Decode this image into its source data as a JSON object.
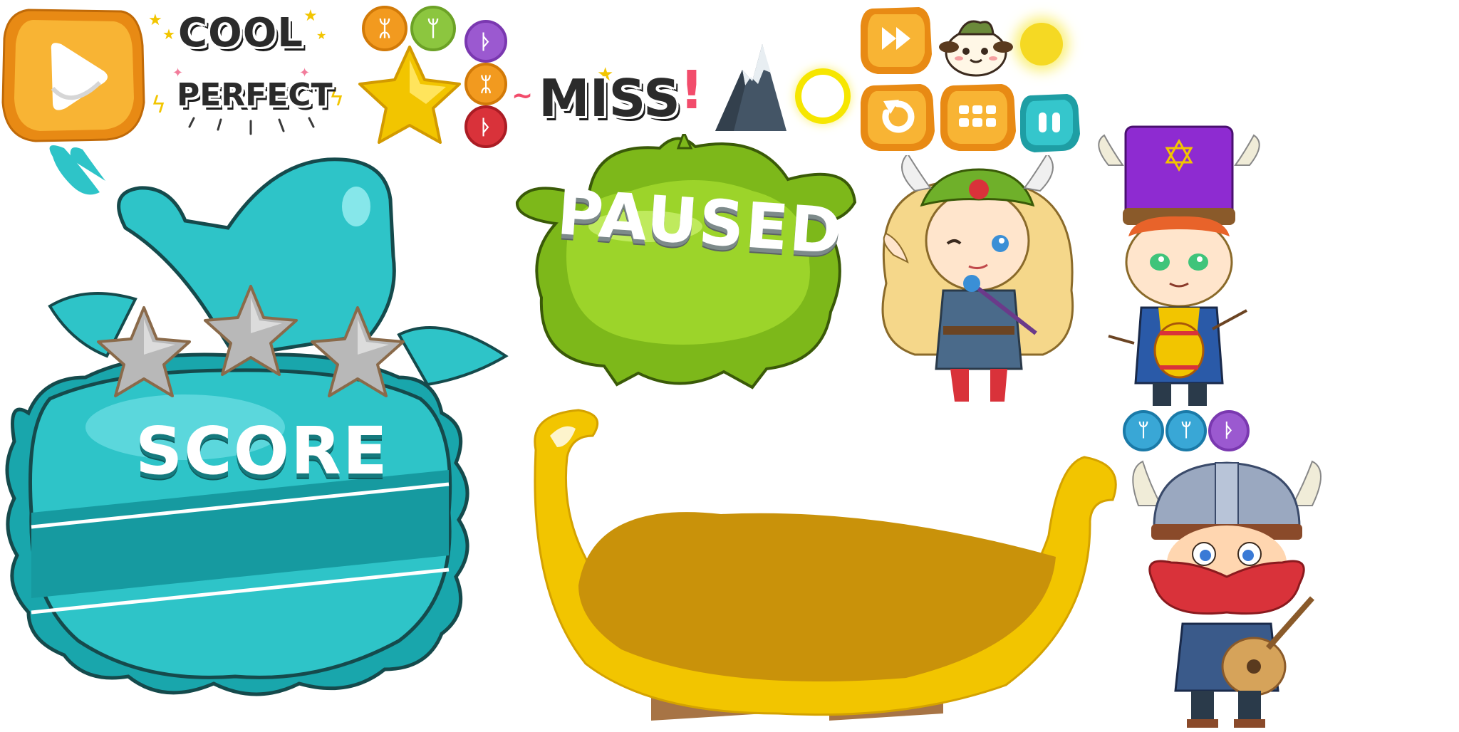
{
  "words": {
    "cool": "COOL",
    "perfect": "PERFECT",
    "miss": "MISS",
    "paused": "PAUSED",
    "score": "SCORE"
  },
  "score_panel": {
    "stars_total": 3,
    "stars_earned": 0
  },
  "buttons": {
    "play": "play-icon",
    "fast_forward": "fast-forward-icon",
    "restart": "restart-icon",
    "menu": "menu-grid-icon",
    "pause": "pause-icon"
  },
  "runes": {
    "top_row": [
      {
        "color": "#f29a1f",
        "glyph": "ᛯ"
      },
      {
        "color": "#8cc63f",
        "glyph": "ᛘ"
      }
    ],
    "right_column": [
      {
        "color": "#9b59d0",
        "glyph": "ᚦ"
      },
      {
        "color": "#f29a1f",
        "glyph": "ᛯ"
      },
      {
        "color": "#d9323a",
        "glyph": "ᚦ"
      }
    ],
    "bottom_row": [
      {
        "color": "#39a7d6",
        "glyph": "ᛘ"
      },
      {
        "color": "#39a7d6",
        "glyph": "ᛘ"
      },
      {
        "color": "#9b59d0",
        "glyph": "ᚦ"
      }
    ]
  },
  "colors": {
    "orange": "#f5a623",
    "teal": "#2ec4c8",
    "green": "#8fce1f",
    "gold": "#f2c500",
    "purple": "#8e2bd1"
  }
}
